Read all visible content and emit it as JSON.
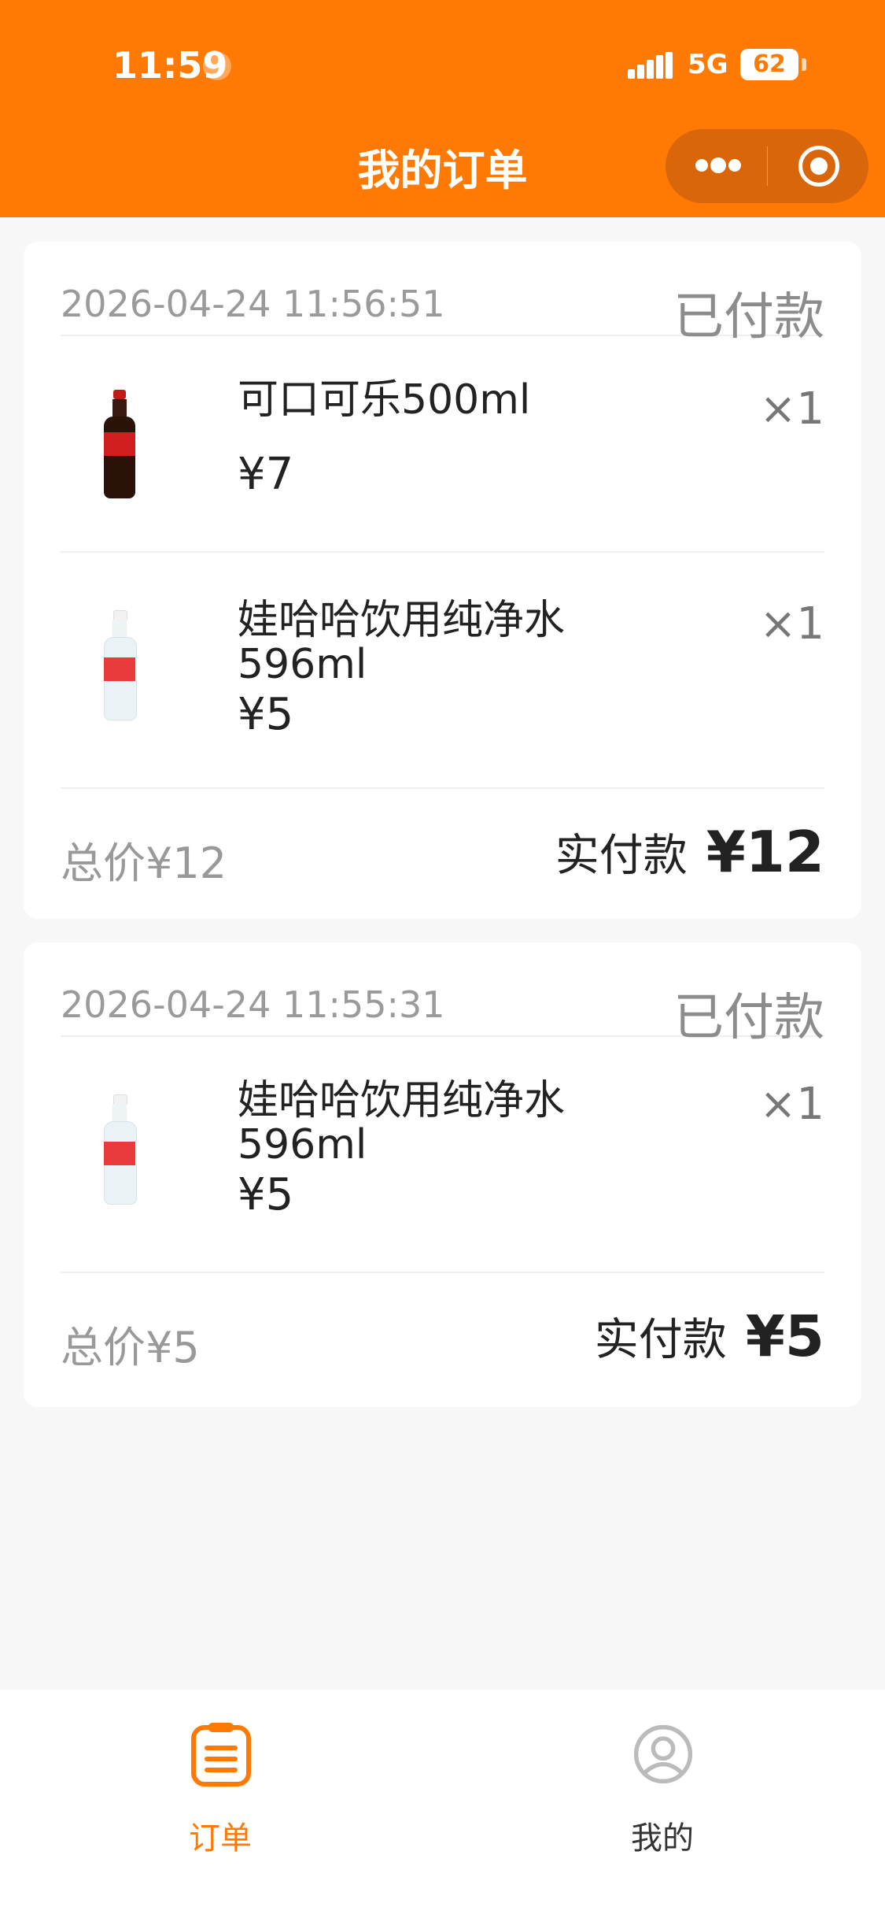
{
  "status_bar": {
    "time": "11:59",
    "network": "5G",
    "battery": "62"
  },
  "header": {
    "title": "我的订单"
  },
  "orders": [
    {
      "time": "2026-04-24 11:56:51",
      "status": "已付款",
      "items": [
        {
          "name": "可口可乐500ml",
          "price": "¥7",
          "qty": "×1",
          "icon": "cola-bottle-icon"
        },
        {
          "name": "娃哈哈饮用纯净水596ml",
          "price": "¥5",
          "qty": "×1",
          "icon": "water-bottle-icon"
        }
      ],
      "total_label": "总价¥12",
      "paid_label": "实付款",
      "paid_amount": "¥12"
    },
    {
      "time": "2026-04-24 11:55:31",
      "status": "已付款",
      "items": [
        {
          "name": "娃哈哈饮用纯净水596ml",
          "price": "¥5",
          "qty": "×1",
          "icon": "water-bottle-icon"
        }
      ],
      "total_label": "总价¥5",
      "paid_label": "实付款",
      "paid_amount": "¥5"
    }
  ],
  "tabbar": {
    "tabs": [
      {
        "label": "订单",
        "icon": "order-list-icon",
        "active": true
      },
      {
        "label": "我的",
        "icon": "profile-icon",
        "active": false
      }
    ]
  },
  "colors": {
    "brand": "#ff7a05",
    "background": "#f7f7f7"
  }
}
